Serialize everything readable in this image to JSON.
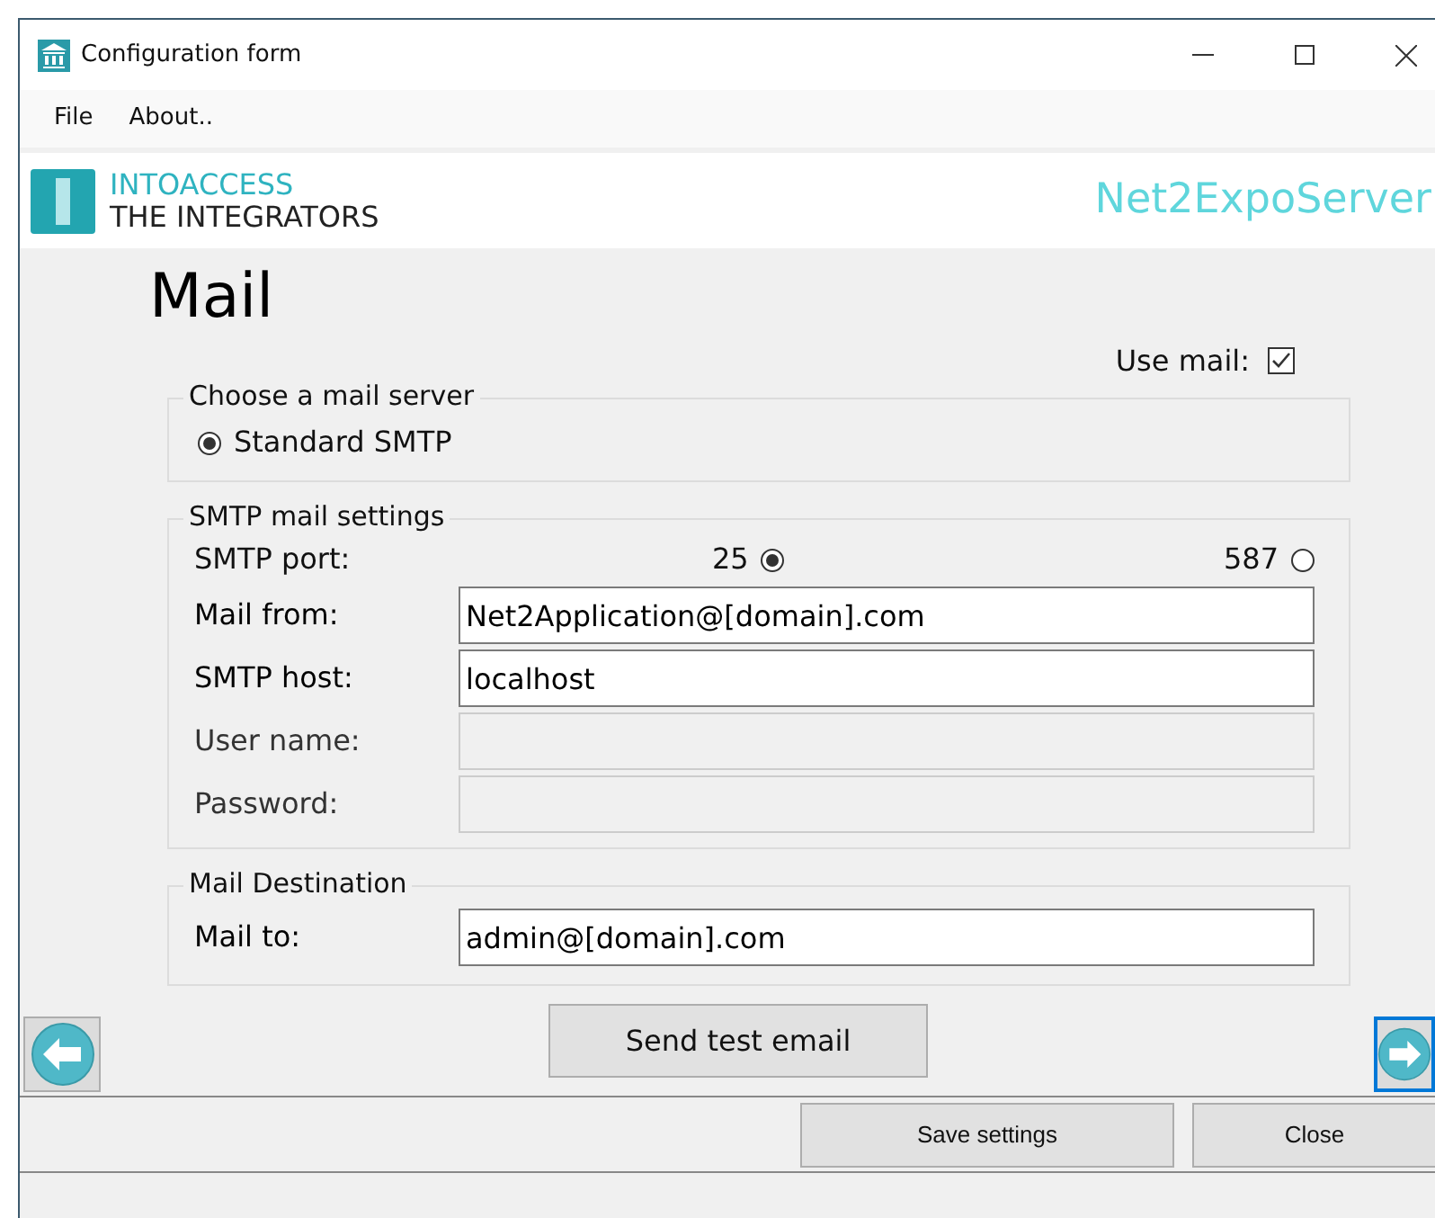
{
  "window": {
    "title": "Configuration form"
  },
  "menu": [
    "File",
    "About.."
  ],
  "header": {
    "logo_line_1": "INTOACCESS",
    "logo_line_2": "THE INTEGRATORS",
    "product": "Net2ExpoServer"
  },
  "page_title": "Mail",
  "use_mail": {
    "label": "Use mail:",
    "checked": true
  },
  "server_group": {
    "title": "Choose a mail server",
    "options": [
      {
        "label": "Standard SMTP",
        "selected": true
      }
    ]
  },
  "smtp_group": {
    "title": "SMTP mail settings",
    "port_label": "SMTP port:",
    "ports": [
      {
        "label": "25",
        "selected": true
      },
      {
        "label": "587",
        "selected": false
      }
    ],
    "fields": [
      {
        "label": "Mail from:",
        "value": "Net2Application@[domain].com",
        "disabled": false
      },
      {
        "label": "SMTP host:",
        "value": "localhost",
        "disabled": false
      },
      {
        "label": "User name:",
        "disabled": true
      },
      {
        "label": "Password:",
        "disabled": true
      }
    ]
  },
  "destination_group": {
    "title": "Mail Destination",
    "fields": [
      {
        "label": "Mail to:",
        "value": "admin@[domain].com",
        "disabled": false
      }
    ]
  },
  "test_button": "Send test email",
  "footer_buttons": [
    "Save settings",
    "Close"
  ]
}
